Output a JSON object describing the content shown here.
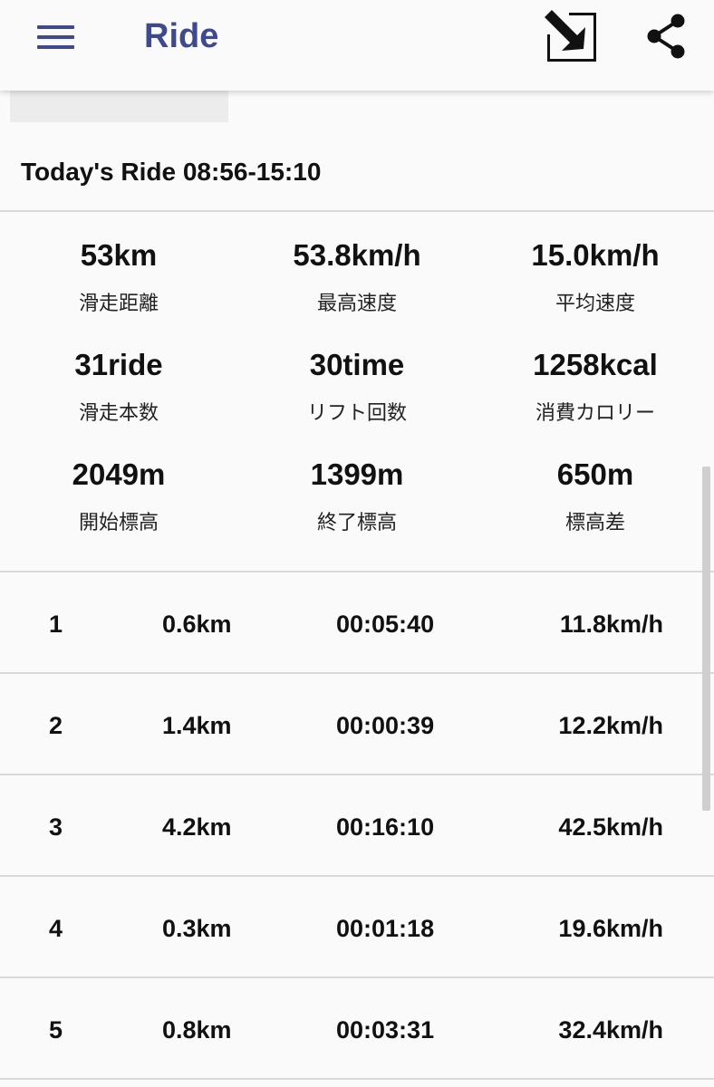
{
  "app_bar": {
    "title": "Ride",
    "menu_icon": "hamburger-menu-icon",
    "open_external_icon": "open-in-new-icon",
    "share_icon": "share-icon",
    "accent_color": "#3f4a8c"
  },
  "summary": {
    "heading": "Today's Ride 08:56-15:10"
  },
  "stats": [
    {
      "value": "53km",
      "label": "滑走距離"
    },
    {
      "value": "53.8km/h",
      "label": "最高速度"
    },
    {
      "value": "15.0km/h",
      "label": "平均速度"
    },
    {
      "value": "31ride",
      "label": "滑走本数"
    },
    {
      "value": "30time",
      "label": "リフト回数"
    },
    {
      "value": "1258kcal",
      "label": "消費カロリー"
    },
    {
      "value": "2049m",
      "label": "開始標高"
    },
    {
      "value": "1399m",
      "label": "終了標高"
    },
    {
      "value": "650m",
      "label": "標高差"
    }
  ],
  "runs": [
    {
      "num": "1",
      "distance": "0.6km",
      "duration": "00:05:40",
      "speed": "11.8km/h"
    },
    {
      "num": "2",
      "distance": "1.4km",
      "duration": "00:00:39",
      "speed": "12.2km/h"
    },
    {
      "num": "3",
      "distance": "4.2km",
      "duration": "00:16:10",
      "speed": "42.5km/h"
    },
    {
      "num": "4",
      "distance": "0.3km",
      "duration": "00:01:18",
      "speed": "19.6km/h"
    },
    {
      "num": "5",
      "distance": "0.8km",
      "duration": "00:03:31",
      "speed": "32.4km/h"
    }
  ]
}
